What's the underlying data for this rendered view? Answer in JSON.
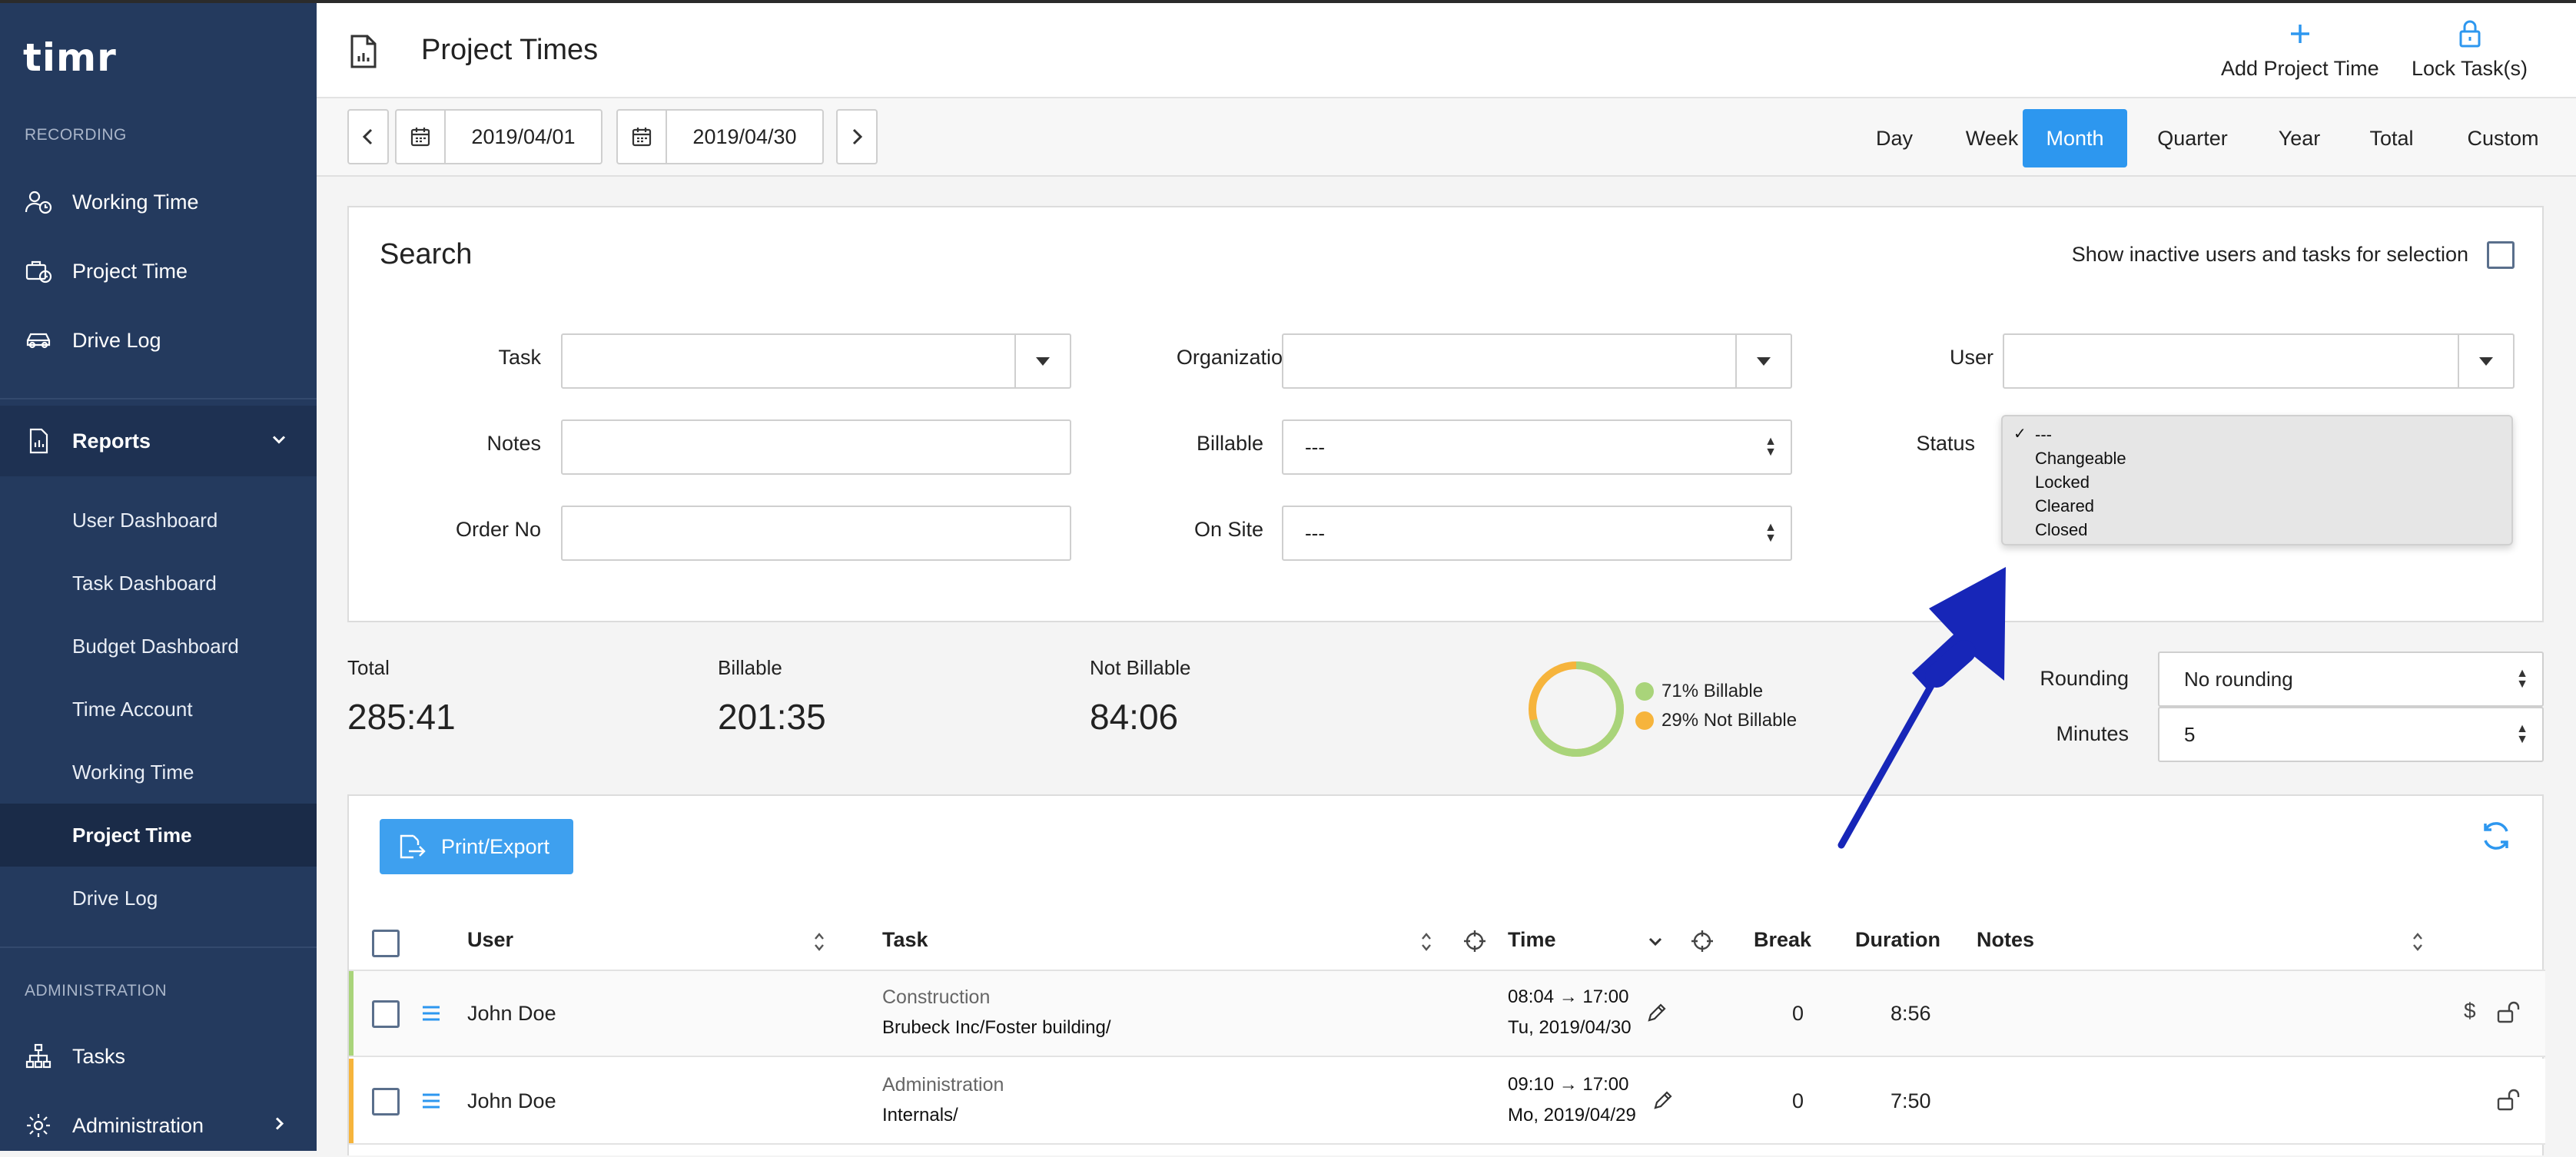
{
  "app": {
    "logo": "timr"
  },
  "sidebar": {
    "recording_title": "RECORDING",
    "recording_items": [
      {
        "label": "Working Time",
        "icon": "user-clock-icon"
      },
      {
        "label": "Project Time",
        "icon": "briefcase-clock-icon"
      },
      {
        "label": "Drive Log",
        "icon": "car-icon"
      }
    ],
    "reports": {
      "label": "Reports",
      "icon": "report-icon"
    },
    "report_items": [
      {
        "label": "User Dashboard"
      },
      {
        "label": "Task Dashboard"
      },
      {
        "label": "Budget Dashboard"
      },
      {
        "label": "Time Account"
      },
      {
        "label": "Working Time"
      },
      {
        "label": "Project Time",
        "active": true
      },
      {
        "label": "Drive Log"
      }
    ],
    "admin_title": "ADMINISTRATION",
    "admin_items": [
      {
        "label": "Tasks",
        "icon": "hierarchy-icon"
      },
      {
        "label": "Administration",
        "icon": "gear-icon"
      }
    ]
  },
  "header": {
    "title": "Project Times",
    "add_label": "Add Project Time",
    "lock_label": "Lock Task(s)"
  },
  "toolbar": {
    "date_from": "2019/04/01",
    "date_to": "2019/04/30",
    "periods": [
      "Day",
      "Week",
      "Month",
      "Quarter",
      "Year",
      "Total",
      "Custom"
    ],
    "active_period": "Month"
  },
  "search": {
    "title": "Search",
    "inactive_label": "Show inactive users and tasks for selection",
    "task_label": "Task",
    "task_value": "",
    "organization_label": "Organization",
    "organization_value": "",
    "user_label": "User",
    "user_value": "",
    "notes_label": "Notes",
    "notes_value": "",
    "billable_label": "Billable",
    "billable_value": "---",
    "status_label": "Status",
    "status_options": [
      "---",
      "Changeable",
      "Locked",
      "Cleared",
      "Closed"
    ],
    "status_selected": "---",
    "orderno_label": "Order No",
    "orderno_value": "",
    "onsite_label": "On Site",
    "onsite_value": "---"
  },
  "summary": {
    "total_label": "Total",
    "total_value": "285:41",
    "billable_label": "Billable",
    "billable_value": "201:35",
    "notbillable_label": "Not Billable",
    "notbillable_value": "84:06",
    "legend_billable": "71% Billable",
    "legend_notbillable": "29% Not Billable",
    "billable_fraction": 0.71,
    "color_billable": "#a9d47a",
    "color_notbillable": "#f6b43c"
  },
  "rounding": {
    "rounding_label": "Rounding",
    "rounding_value": "No rounding",
    "minutes_label": "Minutes",
    "minutes_value": "5"
  },
  "table": {
    "export_label": "Print/Export",
    "columns": {
      "user": "User",
      "task": "Task",
      "time": "Time",
      "break": "Break",
      "duration": "Duration",
      "notes": "Notes"
    },
    "rows": [
      {
        "user": "John Doe",
        "task": "Construction",
        "task_path": "Brubeck Inc/Foster building/",
        "time_range": "08:04 → 17:00",
        "date": "Tu, 2019/04/30",
        "break": "0",
        "duration": "8:56",
        "color": "#a9d47a"
      },
      {
        "user": "John Doe",
        "task": "Administration",
        "task_path": "Internals/",
        "time_range": "09:10 → 17:00",
        "date": "Mo, 2019/04/29",
        "break": "0",
        "duration": "7:50",
        "color": "#f6b43c"
      }
    ]
  },
  "colors": {
    "sidebar": "#243a5e",
    "accent": "#2d97ef",
    "arrow": "#1726b8"
  }
}
